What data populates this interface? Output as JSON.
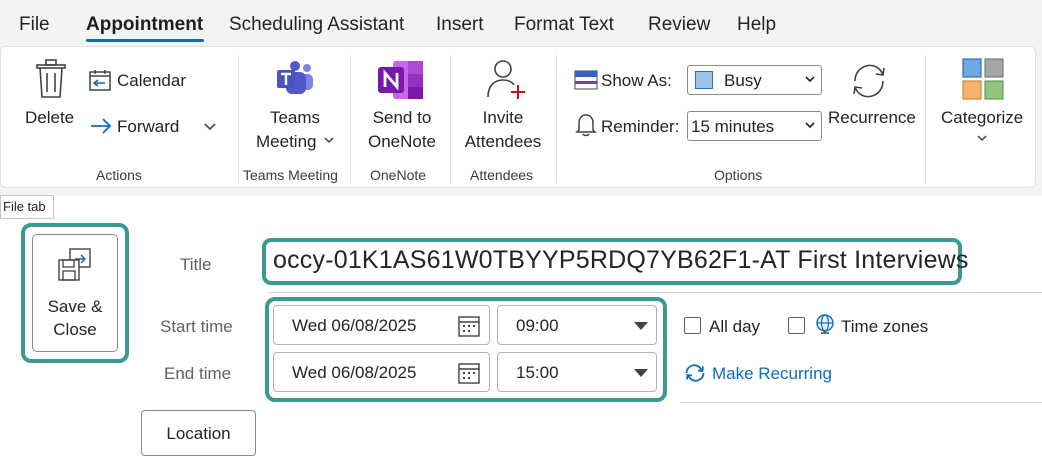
{
  "menu": {
    "file": "File",
    "appointment": "Appointment",
    "scheduling_assistant": "Scheduling Assistant",
    "insert": "Insert",
    "format_text": "Format Text",
    "review": "Review",
    "help": "Help"
  },
  "ribbon": {
    "actions": {
      "delete": "Delete",
      "calendar": "Calendar",
      "forward": "Forward",
      "group_label": "Actions"
    },
    "teams": {
      "line1": "Teams",
      "line2": "Meeting",
      "group_label": "Teams Meeting"
    },
    "onenote": {
      "line1": "Send to",
      "line2": "OneNote",
      "group_label": "OneNote"
    },
    "attendees": {
      "line1": "Invite",
      "line2": "Attendees",
      "group_label": "Attendees"
    },
    "options": {
      "show_as_label": "Show As:",
      "show_as_value": "Busy",
      "reminder_label": "Reminder:",
      "reminder_value": "15 minutes",
      "recurrence": "Recurrence",
      "group_label": "Options"
    },
    "categorize": {
      "label": "Categorize"
    }
  },
  "tooltip": "File tab",
  "form": {
    "save_line1": "Save &",
    "save_line2": "Close",
    "title_label": "Title",
    "title_value": "occy-01K1AS61W0TBYYP5RDQ7YB62F1-AT First Interviews",
    "start_label": "Start time",
    "start_date": "Wed 06/08/2025",
    "start_time": "09:00",
    "end_label": "End time",
    "end_date": "Wed 06/08/2025",
    "end_time": "15:00",
    "all_day": "All day",
    "time_zones": "Time zones",
    "make_recurring": "Make Recurring",
    "location": "Location"
  },
  "colors": {
    "accent": "#0f6cbd",
    "highlight": "#3a9a92",
    "busy": "#6fa8dc"
  }
}
